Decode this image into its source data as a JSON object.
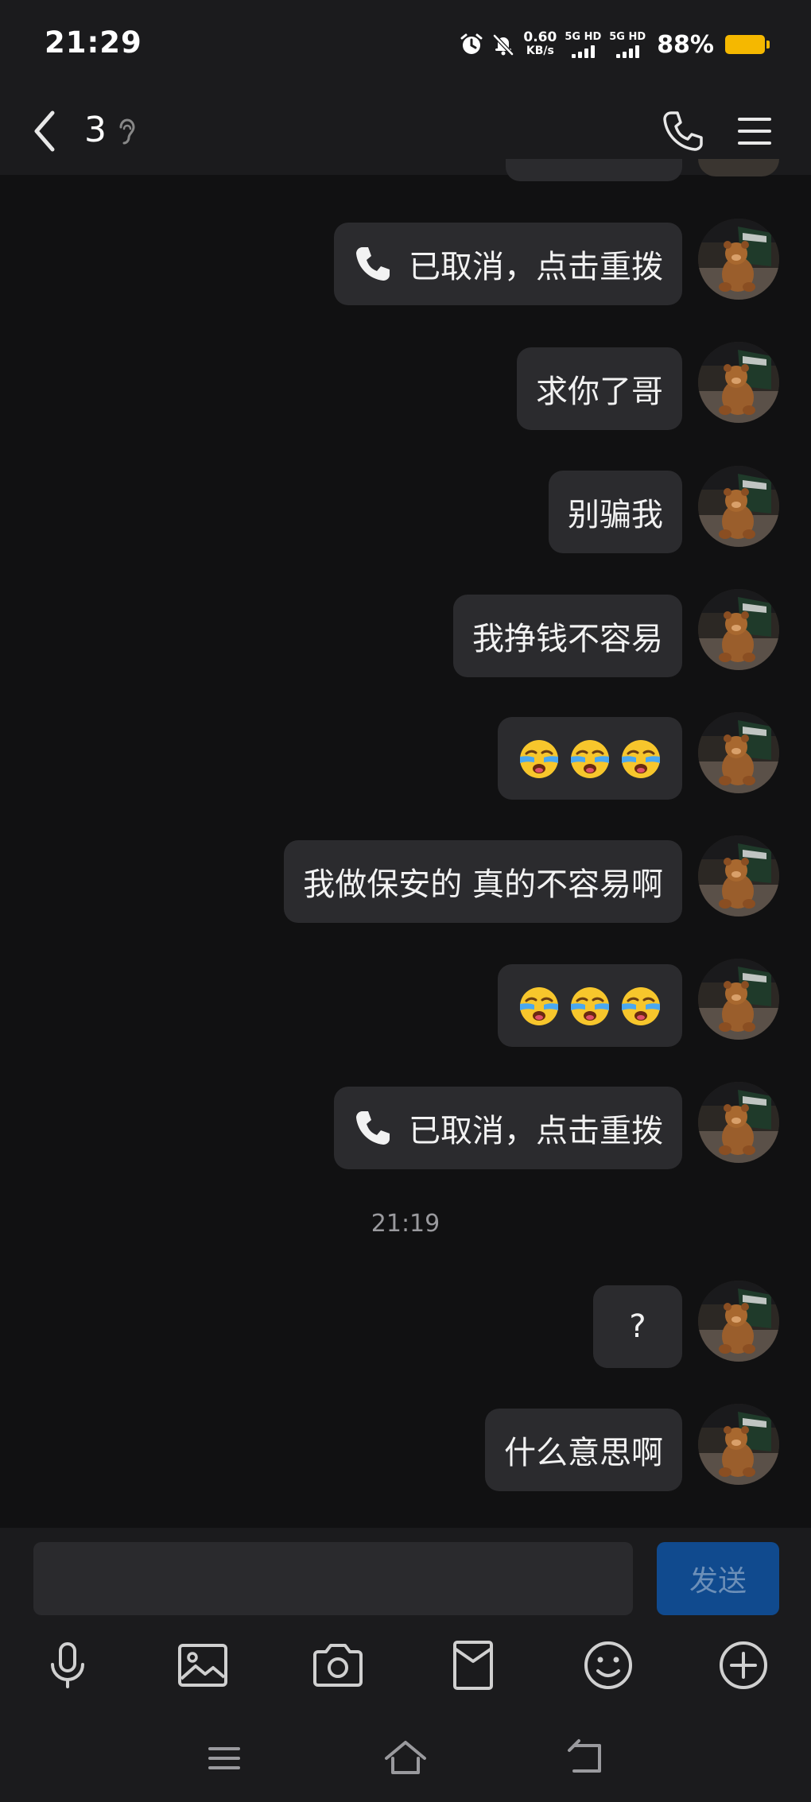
{
  "status_bar": {
    "time": "21:29",
    "speed_value": "0.60",
    "speed_unit": "KB/s",
    "sim1_label": "5G HD",
    "sim2_label": "5G HD",
    "battery_percent": "88%",
    "battery_level": 0.88,
    "icons": [
      "alarm-icon",
      "bell-muted-icon"
    ]
  },
  "header": {
    "title": "3",
    "icons": [
      "back-arrow-icon",
      "ear-icon",
      "phone-icon",
      "menu-icon"
    ]
  },
  "messages": [
    {
      "type": "call",
      "text": "已取消，点击重拨"
    },
    {
      "type": "text",
      "text": "求你了哥"
    },
    {
      "type": "text",
      "text": "别骗我"
    },
    {
      "type": "text",
      "text": "我挣钱不容易"
    },
    {
      "type": "emoji",
      "emoji_count": 3,
      "emoji_name": "crying-face"
    },
    {
      "type": "text",
      "text": "我做保安的 真的不容易啊"
    },
    {
      "type": "emoji",
      "emoji_count": 3,
      "emoji_name": "crying-face"
    },
    {
      "type": "call",
      "text": "已取消，点击重拨"
    },
    {
      "type": "text",
      "text": "?"
    },
    {
      "type": "text",
      "text": "什么意思啊"
    }
  ],
  "timestamp": "21:19",
  "input": {
    "value": "",
    "placeholder": "",
    "send_label": "发送"
  },
  "toolbar": [
    "microphone-icon",
    "image-icon",
    "camera-icon",
    "red-packet-icon",
    "emoji-icon",
    "plus-icon"
  ],
  "navbar": [
    "recent-apps-icon",
    "home-icon",
    "back-icon"
  ],
  "colors": {
    "background": "#111112",
    "bubble": "#2b2b2e",
    "bar": "#1b1b1d",
    "send_button": "#104a8e",
    "battery": "#f5b800"
  }
}
